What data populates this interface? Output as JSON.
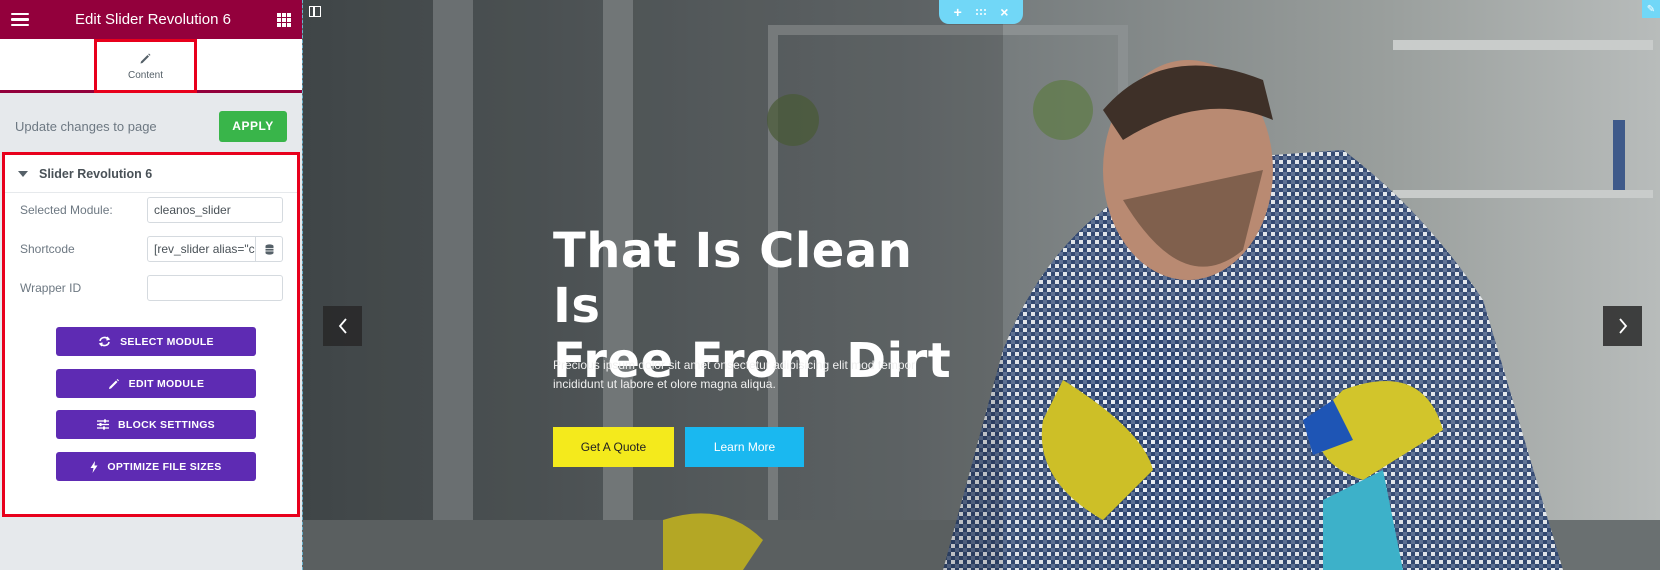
{
  "topbar": {
    "title": "Edit Slider Revolution 6",
    "menu_icon": "hamburger-icon",
    "apps_icon": "grid-icon"
  },
  "tabs": {
    "content_label": "Content"
  },
  "apply_row": {
    "text": "Update changes to page",
    "button_label": "APPLY"
  },
  "section": {
    "title": "Slider Revolution 6",
    "fields": {
      "selected_module_label": "Selected Module:",
      "selected_module_value": "cleanos_slider",
      "shortcode_label": "Shortcode",
      "shortcode_value": "[rev_slider alias=\"c",
      "wrapper_id_label": "Wrapper ID",
      "wrapper_id_value": ""
    },
    "buttons": {
      "select_module": "SELECT MODULE",
      "edit_module": "EDIT MODULE",
      "block_settings": "BLOCK SETTINGS",
      "optimize": "OPTIMIZE FILE SIZES"
    }
  },
  "hero": {
    "title_line1": "That Is Clean Is",
    "title_line2": "Free From Dirt",
    "text_line1": "Precious ipsum dolor sit amet onsectetur adipisicing elit mod tempor",
    "text_line2": "incididunt ut labore et olore magna aliqua.",
    "btn_quote": "Get A Quote",
    "btn_learn": "Learn More"
  },
  "colors": {
    "brand": "#93003c",
    "apply": "#39b54a",
    "purple": "#5e2bb3",
    "highlight": "#e8001c",
    "quote_btn": "#f4ea1c",
    "learn_btn": "#1ab8f0",
    "handle": "#71d7f7"
  }
}
